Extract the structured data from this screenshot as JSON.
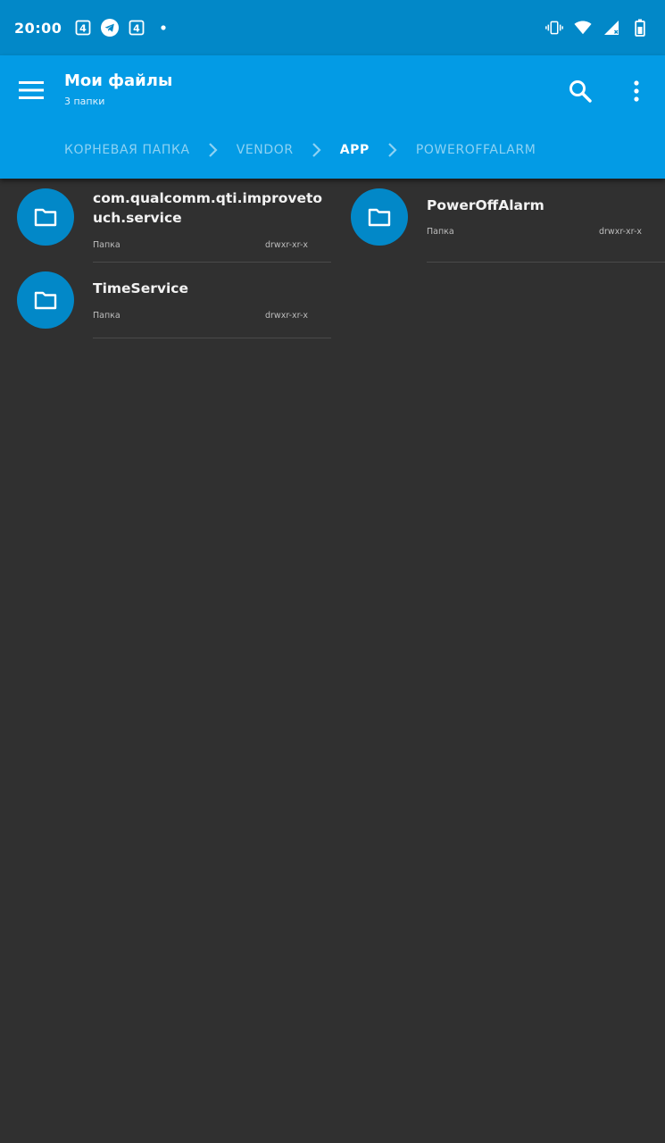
{
  "status_bar": {
    "time": "20:00",
    "left_icons": [
      "sim-4g-icon",
      "telegram-icon",
      "sim-4g-icon",
      "notification-dot-icon"
    ],
    "right_icons": [
      "vibrate-icon",
      "wifi-icon",
      "signal-icon",
      "battery-icon"
    ]
  },
  "app_bar": {
    "title": "Мои файлы",
    "subtitle": "3 папки",
    "breadcrumb": [
      "КОРНЕВАЯ ПАПКА",
      "VENDOR",
      "APP",
      "POWEROFFALARM"
    ],
    "active_crumb_index": 2
  },
  "items": [
    {
      "name_line1": "com.qualcomm.qti.improveto",
      "name_line2": "uch.service",
      "type": "Папка",
      "permissions": "drwxr-xr-x"
    },
    {
      "name": "PowerOffAlarm",
      "type": "Папка",
      "permissions": "drwxr-xr-x"
    },
    {
      "name": "TimeService",
      "type": "Папка",
      "permissions": "drwxr-xr-x"
    }
  ],
  "colors": {
    "status_bar": "#0288c8",
    "app_bar": "#039be5",
    "background": "#303030",
    "folder_circle": "#0288c8"
  }
}
